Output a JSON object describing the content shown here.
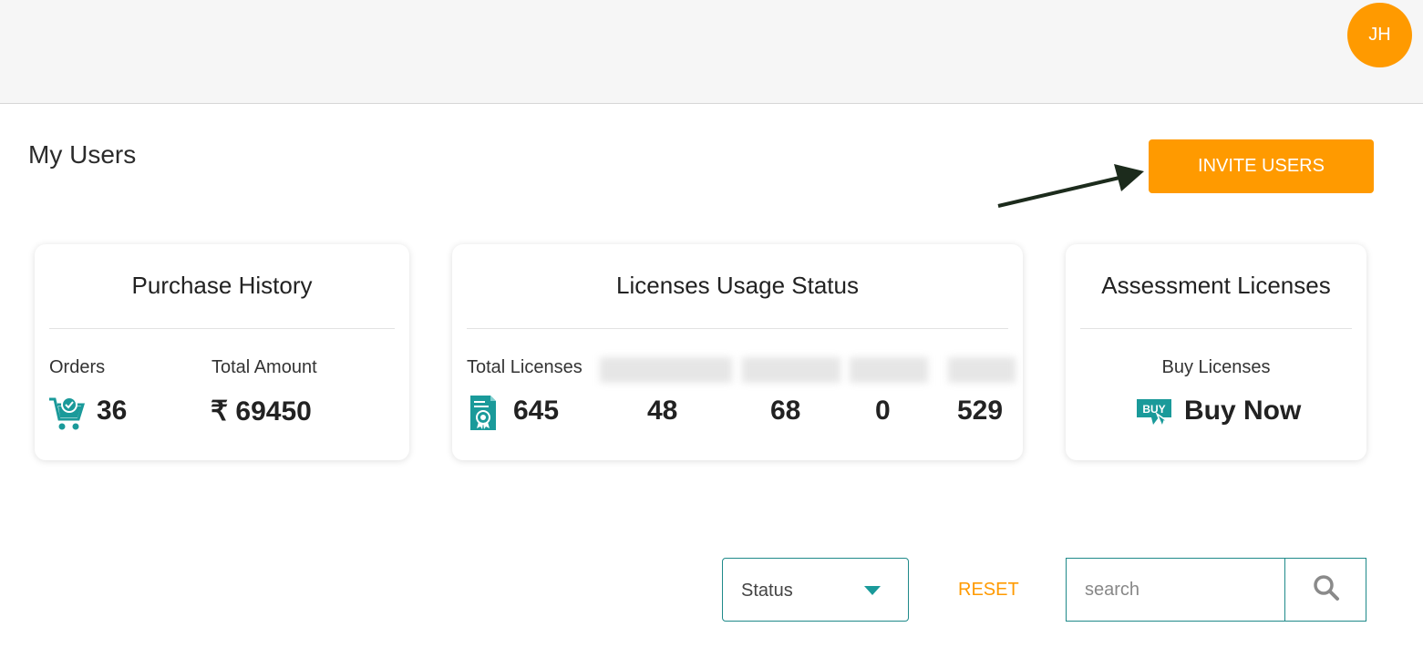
{
  "header": {
    "avatar_initials": "JH"
  },
  "page": {
    "title": "My Users",
    "invite_label": "INVITE USERS"
  },
  "purchase_history": {
    "title": "Purchase History",
    "orders_label": "Orders",
    "orders_value": "36",
    "amount_label": "Total Amount",
    "amount_value": "₹ 69450"
  },
  "licenses_usage": {
    "title": "Licenses Usage Status",
    "total_label": "Total Licenses",
    "total_value": "645",
    "col2_value": "48",
    "col3_value": "68",
    "col4_value": "0",
    "col5_value": "529"
  },
  "assessment_licenses": {
    "title": "Assessment Licenses",
    "buy_label": "Buy Licenses",
    "buy_now": "Buy Now",
    "buy_icon_text": "BUY"
  },
  "filters": {
    "status_label": "Status",
    "reset_label": "RESET",
    "search_placeholder": "search"
  },
  "colors": {
    "accent": "#ff9a00",
    "teal": "#1a9a9a",
    "arrow": "#1c2b1c"
  },
  "icons": [
    "cart-icon",
    "certificate-icon",
    "buy-icon",
    "search-icon",
    "chevron-down-icon"
  ]
}
